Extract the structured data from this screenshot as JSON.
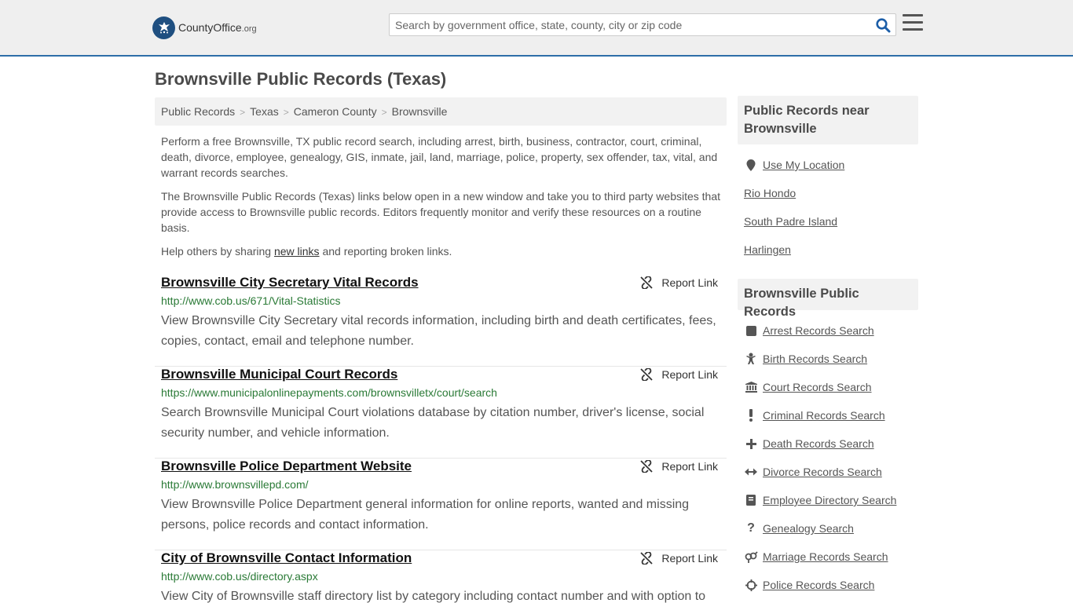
{
  "header": {
    "logo_county": "County",
    "logo_office": "Office",
    "logo_tld": ".org",
    "search_placeholder": "Search by government office, state, county, city or zip code"
  },
  "page_title": "Brownsville Public Records (Texas)",
  "breadcrumb": [
    "Public Records",
    "Texas",
    "Cameron County",
    "Brownsville"
  ],
  "intro": {
    "p1": "Perform a free Brownsville, TX public record search, including arrest, birth, business, contractor, court, criminal, death, divorce, employee, genealogy, GIS, inmate, jail, land, marriage, police, property, sex offender, tax, vital, and warrant records searches.",
    "p2": "The Brownsville Public Records (Texas) links below open in a new window and take you to third party websites that provide access to Brownsville public records. Editors frequently monitor and verify these resources on a routine basis.",
    "p3_before": "Help others by sharing ",
    "p3_link": "new links",
    "p3_after": " and reporting broken links."
  },
  "report_label": "Report Link",
  "records": [
    {
      "title": "Brownsville City Secretary Vital Records",
      "url": "http://www.cob.us/671/Vital-Statistics",
      "desc": "View Brownsville City Secretary vital records information, including birth and death certificates, fees, copies, contact, email and telephone number."
    },
    {
      "title": "Brownsville Municipal Court Records",
      "url": "https://www.municipalonlinepayments.com/brownsvilletx/court/search",
      "desc": "Search Brownsville Municipal Court violations database by citation number, driver's license, social security number, and vehicle information."
    },
    {
      "title": "Brownsville Police Department Website",
      "url": "http://www.brownsvillepd.com/",
      "desc": "View Brownsville Police Department general information for online reports, wanted and missing persons, police records and contact information."
    },
    {
      "title": "City of Brownsville Contact Information",
      "url": "http://www.cob.us/directory.aspx",
      "desc": "View City of Brownsville staff directory list by category including contact number and with option to"
    }
  ],
  "sidebar": {
    "near_heading": "Public Records near Brownsville",
    "near_links": [
      {
        "label": "Use My Location",
        "icon": "location-pin-icon"
      },
      {
        "label": "Rio Hondo"
      },
      {
        "label": "South Padre Island"
      },
      {
        "label": "Harlingen"
      }
    ],
    "records_heading": "Brownsville Public Records",
    "record_links": [
      {
        "label": "Arrest Records Search",
        "icon": "square-icon"
      },
      {
        "label": "Birth Records Search",
        "icon": "baby-icon"
      },
      {
        "label": "Court Records Search",
        "icon": "courthouse-icon"
      },
      {
        "label": "Criminal Records Search",
        "icon": "exclamation-icon"
      },
      {
        "label": "Death Records Search",
        "icon": "cross-icon"
      },
      {
        "label": "Divorce Records Search",
        "icon": "arrows-horizontal-icon"
      },
      {
        "label": "Employee Directory Search",
        "icon": "book-icon"
      },
      {
        "label": "Genealogy Search",
        "icon": "question-icon"
      },
      {
        "label": "Marriage Records Search",
        "icon": "gender-icon"
      },
      {
        "label": "Police Records Search",
        "icon": "crosshair-icon"
      }
    ]
  },
  "colors": {
    "accent": "#2d6ea8",
    "url_green": "#2a7a36",
    "logo_blue": "#1f4f80",
    "search_icon": "#1c5ea8"
  }
}
